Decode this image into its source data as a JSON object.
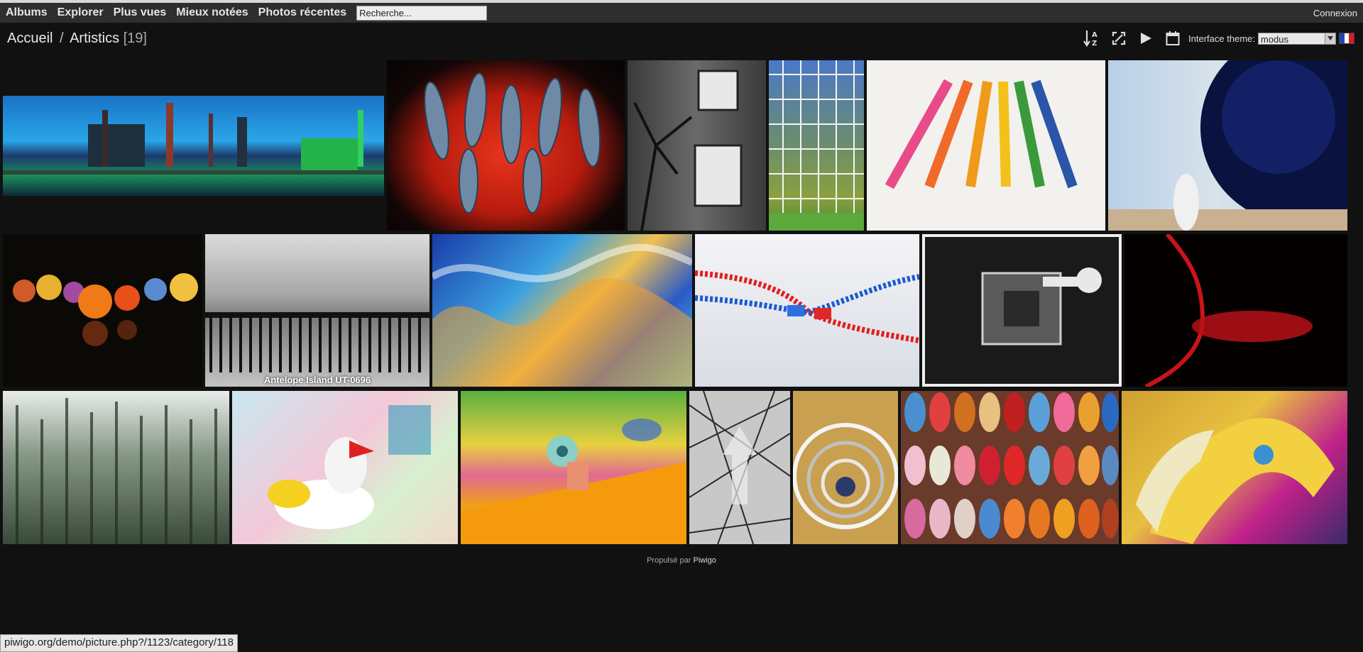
{
  "menu": {
    "items": [
      {
        "label": "Albums"
      },
      {
        "label": "Explorer"
      },
      {
        "label": "Plus vues"
      },
      {
        "label": "Mieux notées"
      },
      {
        "label": "Photos récentes"
      }
    ],
    "search_placeholder": "Recherche...",
    "login": "Connexion"
  },
  "breadcrumb": {
    "home": "Accueil",
    "separator": "/",
    "category": "Artistics",
    "count": "[19]"
  },
  "toolbar": {
    "icons": [
      "sort-az-icon",
      "fullscreen-icon",
      "slideshow-play-icon",
      "calendar-icon"
    ],
    "theme_label": "Interface theme:",
    "theme_value": "modus",
    "language_flag": "french-flag-icon"
  },
  "gallery": {
    "photos": [
      {
        "icon": "steel-plant-night-photo",
        "caption": ""
      },
      {
        "icon": "fish-on-grill-photo",
        "caption": ""
      },
      {
        "icon": "tree-shadow-house-photo",
        "caption": ""
      },
      {
        "icon": "glass-facade-tree-photo",
        "caption": ""
      },
      {
        "icon": "colored-pencils-photo",
        "caption": ""
      },
      {
        "icon": "mirror-sphere-photo",
        "caption": ""
      },
      {
        "icon": "glass-spheres-photo",
        "caption": ""
      },
      {
        "icon": "railing-landscape-photo",
        "caption": "Antelope Island UT-0696"
      },
      {
        "icon": "soap-bubble-colors-photo",
        "caption": ""
      },
      {
        "icon": "zipper-photo",
        "caption": ""
      },
      {
        "icon": "machine-detail-bw-photo",
        "caption": ""
      },
      {
        "icon": "red-smoke-photo",
        "caption": ""
      },
      {
        "icon": "waterfall-photo",
        "caption": ""
      },
      {
        "icon": "toy-rooster-photo",
        "caption": ""
      },
      {
        "icon": "hand-holding-ring-photo",
        "caption": ""
      },
      {
        "icon": "branch-sculpture-photo",
        "caption": ""
      },
      {
        "icon": "spiral-staircase-photo",
        "caption": ""
      },
      {
        "icon": "slippers-photo",
        "caption": ""
      },
      {
        "icon": "carousel-horses-photo",
        "caption": ""
      }
    ]
  },
  "footer": {
    "prefix": "Propulsé par",
    "link": "Piwigo"
  },
  "statusbar": {
    "url": "piwigo.org/demo/picture.php?/1123/category/118"
  }
}
